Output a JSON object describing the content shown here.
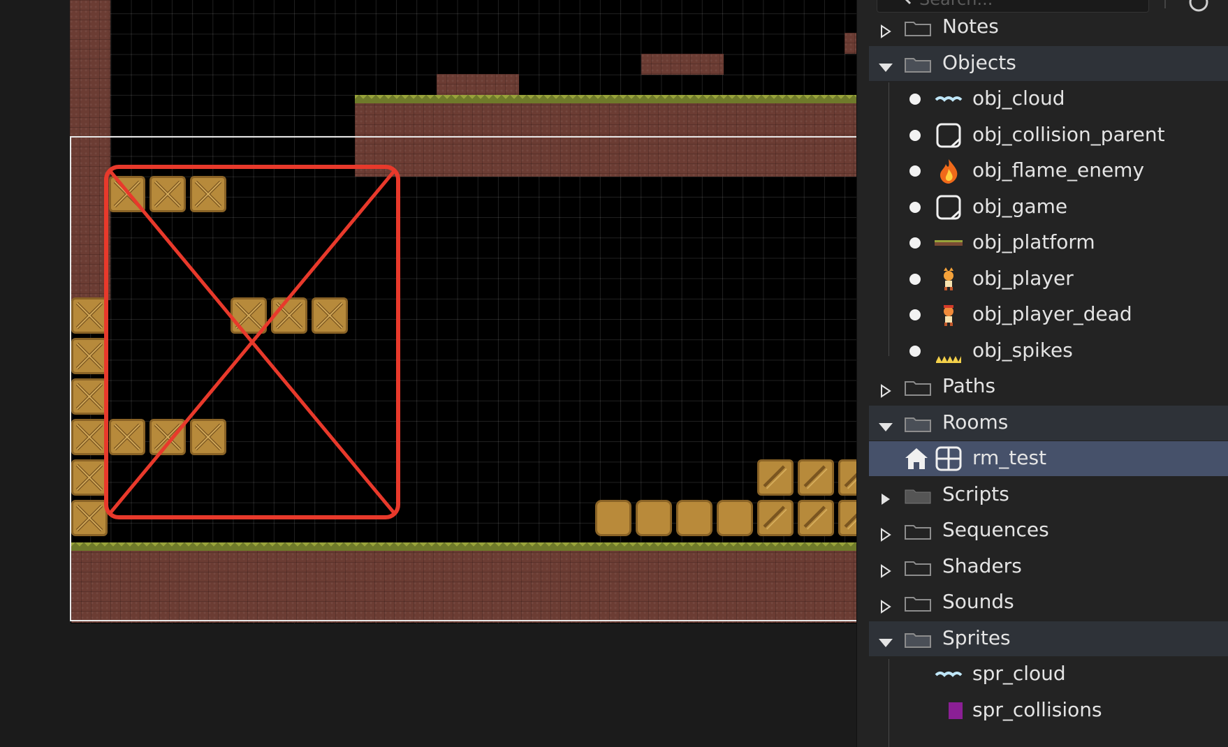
{
  "search": {
    "placeholder": "Search..."
  },
  "tree": {
    "folders": {
      "notes": "Notes",
      "objects": "Objects",
      "paths": "Paths",
      "rooms": "Rooms",
      "scripts": "Scripts",
      "sequences": "Sequences",
      "shaders": "Shaders",
      "sounds": "Sounds",
      "sprites": "Sprites"
    },
    "objects": [
      {
        "label": "obj_cloud",
        "icon": "cloud-icon"
      },
      {
        "label": "obj_collision_parent",
        "icon": "object-outline-icon"
      },
      {
        "label": "obj_flame_enemy",
        "icon": "flame-icon"
      },
      {
        "label": "obj_game",
        "icon": "object-outline-icon"
      },
      {
        "label": "obj_platform",
        "icon": "platform-icon"
      },
      {
        "label": "obj_player",
        "icon": "player-icon"
      },
      {
        "label": "obj_player_dead",
        "icon": "player-dead-icon"
      },
      {
        "label": "obj_spikes",
        "icon": "spikes-icon"
      }
    ],
    "rooms": [
      {
        "label": "rm_test",
        "icon": "room-icon",
        "start_room": true,
        "selected": true
      }
    ],
    "sprites": [
      {
        "label": "spr_cloud",
        "icon": "cloud-icon"
      },
      {
        "label": "spr_collisions",
        "icon": "purple-square-icon"
      }
    ]
  },
  "colors": {
    "collision_outline": "#e8392b",
    "selection": "#46516a",
    "open_folder_row": "#2e3238",
    "crate": "#b78a3b",
    "dirt": "#6b3c33",
    "grass": "#98a33a"
  }
}
